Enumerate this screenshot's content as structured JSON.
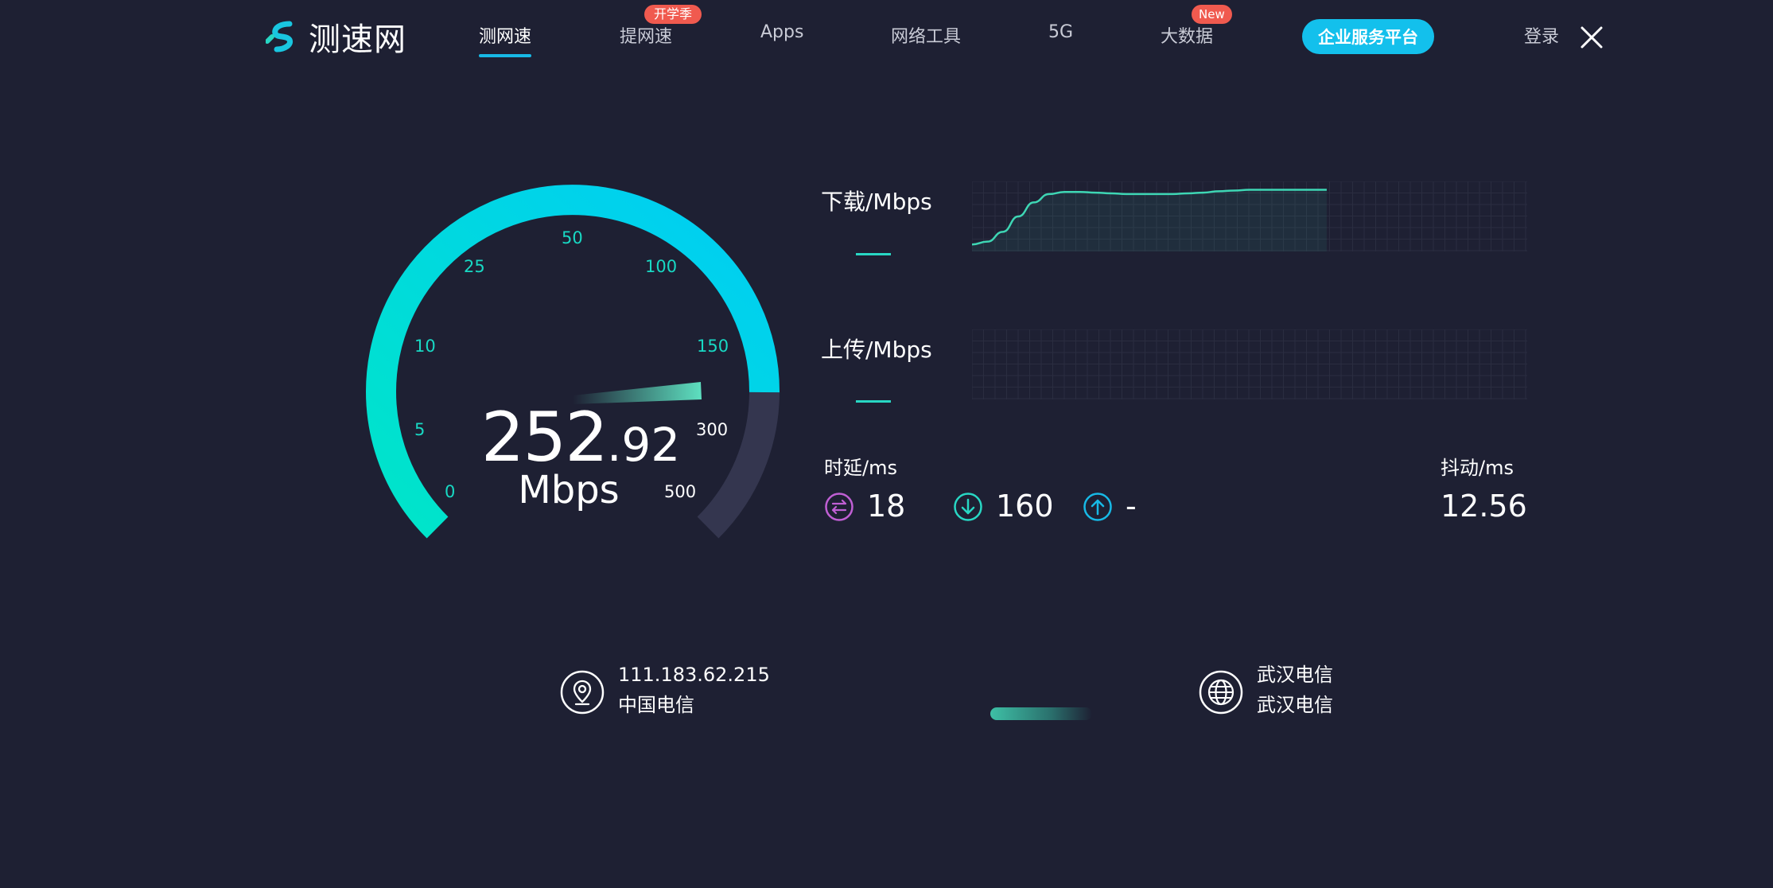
{
  "header": {
    "logo_text": "测速网",
    "nav": [
      {
        "label": "测网速",
        "active": true
      },
      {
        "label": "提网速",
        "badge": "开学季"
      },
      {
        "label": "Apps"
      },
      {
        "label": "网络工具"
      },
      {
        "label": "5G"
      },
      {
        "label": "大数据",
        "badge": "New"
      }
    ],
    "cta_label": "企业服务平台",
    "login_label": "登录"
  },
  "gauge": {
    "value_int": "252",
    "value_dec": ".92",
    "unit": "Mbps",
    "ticks": [
      "0",
      "5",
      "10",
      "25",
      "50",
      "100",
      "150",
      "300",
      "500"
    ],
    "colors": {
      "arc_start": "#00e5c8",
      "arc_end": "#00cdf5",
      "arc_rest": "#34364f",
      "needle": "#5ee0c0"
    }
  },
  "chart_data": [
    {
      "type": "area",
      "title": "下载/Mbps",
      "x": [
        0,
        1,
        2,
        3,
        4,
        5,
        6,
        7,
        8,
        9,
        10,
        11,
        12,
        13,
        14,
        15,
        16,
        17,
        18,
        19,
        20,
        21,
        22,
        23,
        24,
        25,
        26,
        27,
        28,
        29,
        30,
        31,
        32,
        33,
        34,
        35,
        36
      ],
      "values": [
        0.1,
        0.14,
        0.28,
        0.5,
        0.7,
        0.82,
        0.85,
        0.85,
        0.84,
        0.83,
        0.82,
        0.82,
        0.82,
        0.82,
        0.83,
        0.84,
        0.86,
        0.87,
        0.88,
        0.88,
        0.88,
        0.88,
        0.88,
        0.88
      ],
      "color": "#3ed6b4"
    },
    {
      "type": "area",
      "title": "上传/Mbps",
      "values": []
    }
  ],
  "stats": {
    "latency_label": "时延/ms",
    "jitter_label": "抖动/ms",
    "ping": "18",
    "download_latency": "160",
    "upload_latency": "-",
    "jitter": "12.56",
    "icon_colors": {
      "ping": "#c05fd4",
      "download": "#28d7c4",
      "upload": "#17b9e6"
    }
  },
  "client": {
    "ip": "111.183.62.215",
    "isp": "中国电信"
  },
  "server": {
    "name": "武汉电信",
    "isp": "武汉电信"
  }
}
